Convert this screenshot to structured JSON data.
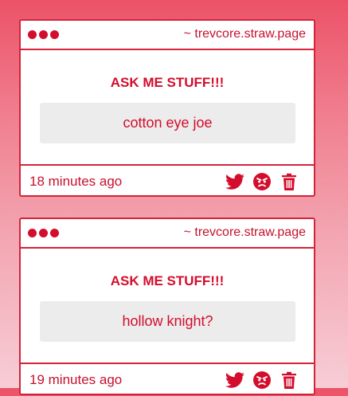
{
  "posts": [
    {
      "url": "~ trevcore.straw.page",
      "heading": "ASK ME STUFF!!!",
      "answer": "cotton eye joe",
      "time": "18 minutes ago"
    },
    {
      "url": "~ trevcore.straw.page",
      "heading": "ASK ME STUFF!!!",
      "answer": "hollow knight?",
      "time": "19 minutes ago"
    }
  ],
  "icons": [
    "twitter-icon",
    "angry-face-icon",
    "trash-icon"
  ],
  "colors": {
    "accent": "#d40d2c",
    "border": "#d4233b",
    "answer_bg": "#ececec",
    "card_bg": "#ffffff"
  }
}
